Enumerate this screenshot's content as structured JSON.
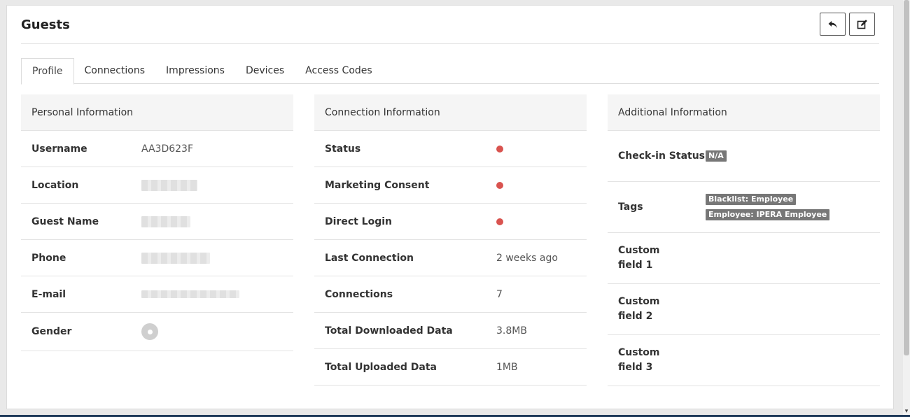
{
  "page": {
    "title": "Guests"
  },
  "header_buttons": [
    {
      "name": "back",
      "icon": "reply-icon"
    },
    {
      "name": "edit",
      "icon": "edit-icon"
    }
  ],
  "tabs": [
    {
      "label": "Profile",
      "active": true
    },
    {
      "label": "Connections",
      "active": false
    },
    {
      "label": "Impressions",
      "active": false
    },
    {
      "label": "Devices",
      "active": false
    },
    {
      "label": "Access Codes",
      "active": false
    }
  ],
  "personal": {
    "title": "Personal Information",
    "rows": [
      {
        "label": "Username",
        "value": "AA3D623F"
      },
      {
        "label": "Location",
        "value": ""
      },
      {
        "label": "Guest Name",
        "value": ""
      },
      {
        "label": "Phone",
        "value": ""
      },
      {
        "label": "E-mail",
        "value": ""
      },
      {
        "label": "Gender",
        "value": ""
      }
    ]
  },
  "connection": {
    "title": "Connection Information",
    "rows": [
      {
        "label": "Status",
        "value": ""
      },
      {
        "label": "Marketing Consent",
        "value": ""
      },
      {
        "label": "Direct Login",
        "value": ""
      },
      {
        "label": "Last Connection",
        "value": "2 weeks ago"
      },
      {
        "label": "Connections",
        "value": "7"
      },
      {
        "label": "Total Downloaded Data",
        "value": "3.8MB"
      },
      {
        "label": "Total Uploaded Data",
        "value": "1MB"
      }
    ],
    "status_color": "#d9534f"
  },
  "additional": {
    "title": "Additional Information",
    "rows": [
      {
        "label": "Check-in Status",
        "badges": [
          "N/A"
        ]
      },
      {
        "label": "Tags",
        "badges": [
          "Blacklist: Employee",
          "Employee: IPERA Employee"
        ]
      },
      {
        "label": "Custom field 1",
        "badges": []
      },
      {
        "label": "Custom field 2",
        "badges": []
      },
      {
        "label": "Custom field 3",
        "badges": []
      }
    ]
  }
}
